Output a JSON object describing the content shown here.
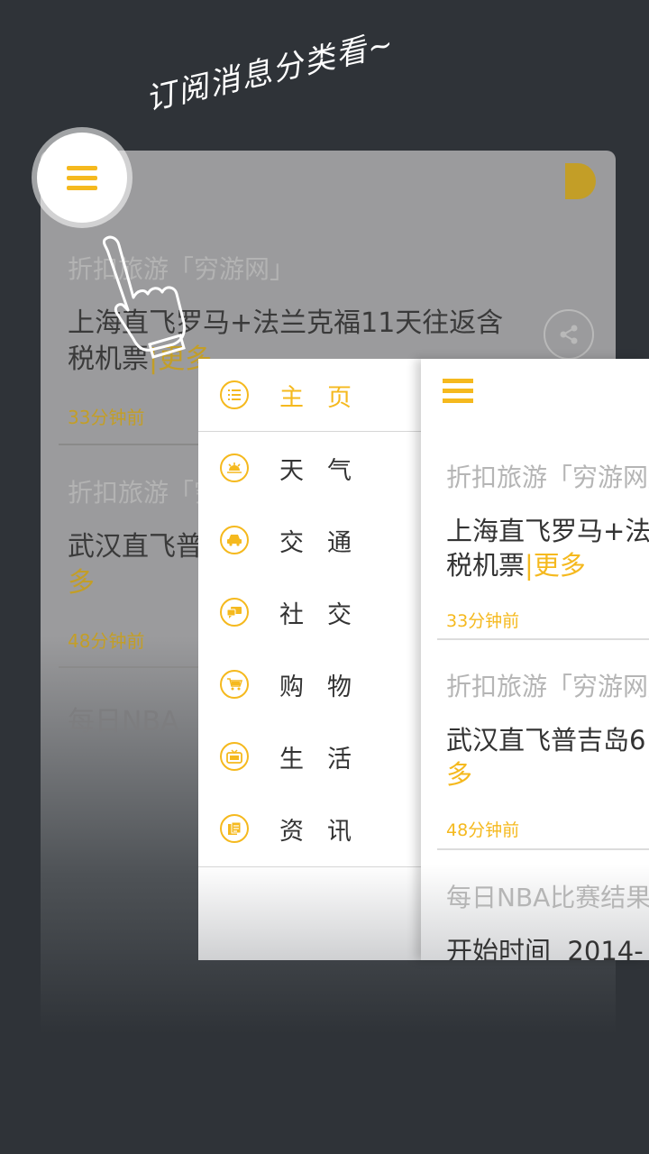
{
  "hint": "订阅消息分类看~",
  "menu": {
    "items": [
      {
        "label": "主页",
        "icon": "list-icon"
      },
      {
        "label": "天气",
        "icon": "sunrise-icon"
      },
      {
        "label": "交通",
        "icon": "car-icon"
      },
      {
        "label": "社交",
        "icon": "chat-bubbles-icon"
      },
      {
        "label": "购物",
        "icon": "shopping-cart-icon"
      },
      {
        "label": "生活",
        "icon": "tv-icon"
      },
      {
        "label": "资讯",
        "icon": "news-icon"
      }
    ],
    "active_index": 0
  },
  "feed": [
    {
      "source": "折扣旅游「穷游网」",
      "title_line1": "上海直飞罗马+法兰克福11天往返含",
      "title_line2": "税机票",
      "more": "|更多",
      "time": "33分钟前"
    },
    {
      "source": "折扣旅游「穷游网」",
      "title_line1": "武汉直飞普吉岛6",
      "title_line2": "",
      "more": "多",
      "time": "48分钟前"
    },
    {
      "source": "每日NBA比赛结果",
      "title_line1": "开始时间  2014-",
      "title_line2": "",
      "more": "",
      "time": ""
    }
  ],
  "background_feed": {
    "item2_title": "武汉直飞普",
    "item2_more": "多",
    "item3_source": "每日NBA"
  },
  "colors": {
    "accent": "#f5b91e",
    "background": "#2f3338"
  }
}
